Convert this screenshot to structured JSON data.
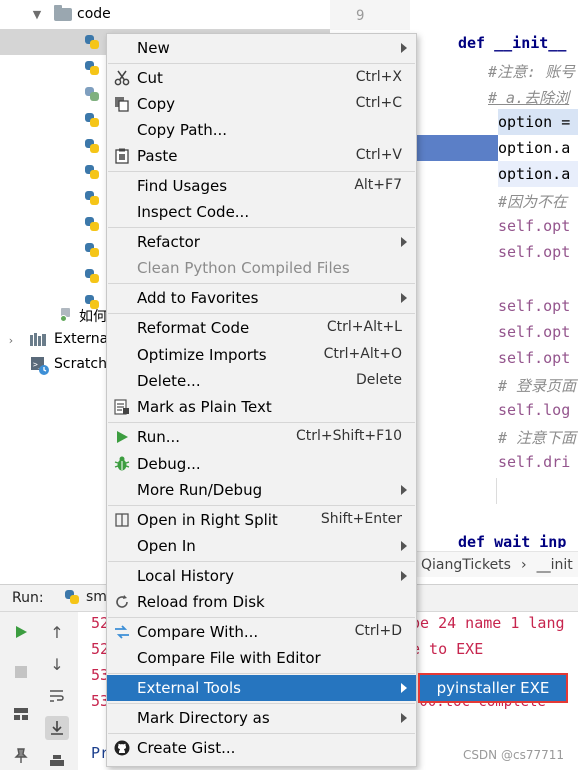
{
  "tree": {
    "folder_label": "code",
    "item_label_1": "如何",
    "external_label": "Externa",
    "scratch_label": "Scratch"
  },
  "gutter": {
    "line_number": "9"
  },
  "editor": {
    "line_def": "def __init__",
    "comment_1": "#注意: 账号",
    "comment_2": "# a.去除浏",
    "line_option_1": "option =",
    "line_option_2": "option.a",
    "line_option_3": "option.a",
    "comment_3": "#因为不在",
    "self_opt_1": "self.opt",
    "self_opt_2": "self.opt",
    "self_opt_3": "self.opt",
    "self_opt_4": "self.opt",
    "self_opt_5": "self.opt",
    "comment_4": "# 登录页面",
    "self_log": "self.log",
    "comment_5": "# 注意下面",
    "self_dri": "self.dri",
    "line_def2": "def wait_inp"
  },
  "breadcrumb": {
    "class_name": "QiangTickets",
    "method_name": "__init"
  },
  "run_panel": {
    "label": "Run:",
    "tab_label": "sm",
    "lines": [
      "52",
      "52",
      "53",
      "53",
      "Pr"
    ],
    "line1_tail": "pe 24 name 1 lang",
    "line2_tail": "e to EXE",
    "line4_tail": "-00.toc complete"
  },
  "context_menu": {
    "items": [
      {
        "label": "New",
        "shortcut": ""
      },
      {
        "label": "Cut",
        "shortcut": "Ctrl+X"
      },
      {
        "label": "Copy",
        "shortcut": "Ctrl+C"
      },
      {
        "label": "Copy Path...",
        "shortcut": ""
      },
      {
        "label": "Paste",
        "shortcut": "Ctrl+V"
      },
      {
        "label": "Find Usages",
        "shortcut": "Alt+F7"
      },
      {
        "label": "Inspect Code...",
        "shortcut": ""
      },
      {
        "label": "Refactor",
        "shortcut": ""
      },
      {
        "label": "Clean Python Compiled Files",
        "shortcut": ""
      },
      {
        "label": "Add to Favorites",
        "shortcut": ""
      },
      {
        "label": "Reformat Code",
        "shortcut": "Ctrl+Alt+L"
      },
      {
        "label": "Optimize Imports",
        "shortcut": "Ctrl+Alt+O"
      },
      {
        "label": "Delete...",
        "shortcut": "Delete"
      },
      {
        "label": "Mark as Plain Text",
        "shortcut": ""
      },
      {
        "label": "Run...",
        "shortcut": "Ctrl+Shift+F10"
      },
      {
        "label": "Debug...",
        "shortcut": ""
      },
      {
        "label": "More Run/Debug",
        "shortcut": ""
      },
      {
        "label": "Open in Right Split",
        "shortcut": "Shift+Enter"
      },
      {
        "label": "Open In",
        "shortcut": ""
      },
      {
        "label": "Local History",
        "shortcut": ""
      },
      {
        "label": "Reload from Disk",
        "shortcut": ""
      },
      {
        "label": "Compare With...",
        "shortcut": "Ctrl+D"
      },
      {
        "label": "Compare File with Editor",
        "shortcut": ""
      },
      {
        "label": "External Tools",
        "shortcut": ""
      },
      {
        "label": "Mark Directory as",
        "shortcut": ""
      },
      {
        "label": "Create Gist...",
        "shortcut": ""
      }
    ]
  },
  "submenu": {
    "item_label": "pyinstaller EXE"
  },
  "watermark": "CSDN @cs77711",
  "colors": {
    "selection": "#2675bf",
    "highlight_border": "#e53935",
    "run_green": "#3c9d40",
    "menu_bg": "#f2f2f2"
  }
}
